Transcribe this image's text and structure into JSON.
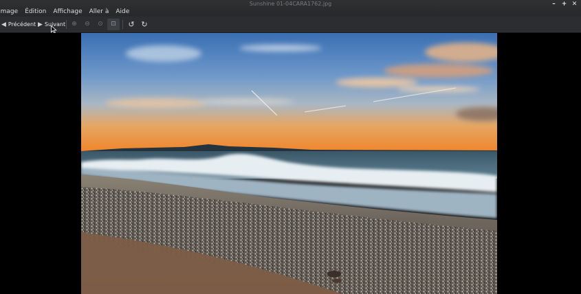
{
  "window": {
    "title": "Sunshine 01-04CARA1762.jpg",
    "controls": [
      "–",
      "+",
      "✕"
    ]
  },
  "menu": {
    "items": [
      "Image",
      "Édition",
      "Affichage",
      "Aller à",
      "Aide"
    ]
  },
  "toolbar": {
    "previous_label": "Précédent",
    "next_label": "Suivant",
    "icons": {
      "previous": "arrow-left-icon",
      "next": "arrow-right-icon",
      "zoom_in": "zoom-in-icon",
      "zoom_out": "zoom-out-icon",
      "zoom_normal": "zoom-original-icon",
      "zoom_fit": "zoom-fit-icon",
      "rotate_left": "rotate-left-icon",
      "rotate_right": "rotate-right-icon"
    }
  },
  "colors": {
    "titlebar": "#2a2c2e",
    "toolbar": "#2b2d30",
    "viewer_background": "#000000"
  }
}
